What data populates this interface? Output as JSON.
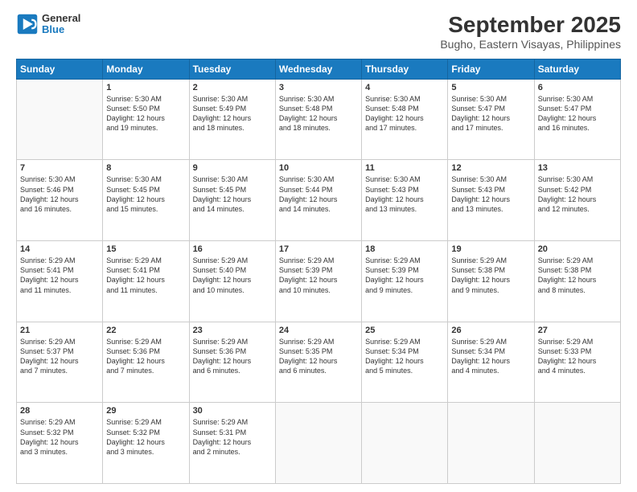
{
  "header": {
    "logo_line1": "General",
    "logo_line2": "Blue",
    "title": "September 2025",
    "subtitle": "Bugho, Eastern Visayas, Philippines"
  },
  "days": [
    "Sunday",
    "Monday",
    "Tuesday",
    "Wednesday",
    "Thursday",
    "Friday",
    "Saturday"
  ],
  "weeks": [
    [
      {
        "day": "",
        "info": ""
      },
      {
        "day": "1",
        "info": "Sunrise: 5:30 AM\nSunset: 5:50 PM\nDaylight: 12 hours\nand 19 minutes."
      },
      {
        "day": "2",
        "info": "Sunrise: 5:30 AM\nSunset: 5:49 PM\nDaylight: 12 hours\nand 18 minutes."
      },
      {
        "day": "3",
        "info": "Sunrise: 5:30 AM\nSunset: 5:48 PM\nDaylight: 12 hours\nand 18 minutes."
      },
      {
        "day": "4",
        "info": "Sunrise: 5:30 AM\nSunset: 5:48 PM\nDaylight: 12 hours\nand 17 minutes."
      },
      {
        "day": "5",
        "info": "Sunrise: 5:30 AM\nSunset: 5:47 PM\nDaylight: 12 hours\nand 17 minutes."
      },
      {
        "day": "6",
        "info": "Sunrise: 5:30 AM\nSunset: 5:47 PM\nDaylight: 12 hours\nand 16 minutes."
      }
    ],
    [
      {
        "day": "7",
        "info": "Sunrise: 5:30 AM\nSunset: 5:46 PM\nDaylight: 12 hours\nand 16 minutes."
      },
      {
        "day": "8",
        "info": "Sunrise: 5:30 AM\nSunset: 5:45 PM\nDaylight: 12 hours\nand 15 minutes."
      },
      {
        "day": "9",
        "info": "Sunrise: 5:30 AM\nSunset: 5:45 PM\nDaylight: 12 hours\nand 14 minutes."
      },
      {
        "day": "10",
        "info": "Sunrise: 5:30 AM\nSunset: 5:44 PM\nDaylight: 12 hours\nand 14 minutes."
      },
      {
        "day": "11",
        "info": "Sunrise: 5:30 AM\nSunset: 5:43 PM\nDaylight: 12 hours\nand 13 minutes."
      },
      {
        "day": "12",
        "info": "Sunrise: 5:30 AM\nSunset: 5:43 PM\nDaylight: 12 hours\nand 13 minutes."
      },
      {
        "day": "13",
        "info": "Sunrise: 5:30 AM\nSunset: 5:42 PM\nDaylight: 12 hours\nand 12 minutes."
      }
    ],
    [
      {
        "day": "14",
        "info": "Sunrise: 5:29 AM\nSunset: 5:41 PM\nDaylight: 12 hours\nand 11 minutes."
      },
      {
        "day": "15",
        "info": "Sunrise: 5:29 AM\nSunset: 5:41 PM\nDaylight: 12 hours\nand 11 minutes."
      },
      {
        "day": "16",
        "info": "Sunrise: 5:29 AM\nSunset: 5:40 PM\nDaylight: 12 hours\nand 10 minutes."
      },
      {
        "day": "17",
        "info": "Sunrise: 5:29 AM\nSunset: 5:39 PM\nDaylight: 12 hours\nand 10 minutes."
      },
      {
        "day": "18",
        "info": "Sunrise: 5:29 AM\nSunset: 5:39 PM\nDaylight: 12 hours\nand 9 minutes."
      },
      {
        "day": "19",
        "info": "Sunrise: 5:29 AM\nSunset: 5:38 PM\nDaylight: 12 hours\nand 9 minutes."
      },
      {
        "day": "20",
        "info": "Sunrise: 5:29 AM\nSunset: 5:38 PM\nDaylight: 12 hours\nand 8 minutes."
      }
    ],
    [
      {
        "day": "21",
        "info": "Sunrise: 5:29 AM\nSunset: 5:37 PM\nDaylight: 12 hours\nand 7 minutes."
      },
      {
        "day": "22",
        "info": "Sunrise: 5:29 AM\nSunset: 5:36 PM\nDaylight: 12 hours\nand 7 minutes."
      },
      {
        "day": "23",
        "info": "Sunrise: 5:29 AM\nSunset: 5:36 PM\nDaylight: 12 hours\nand 6 minutes."
      },
      {
        "day": "24",
        "info": "Sunrise: 5:29 AM\nSunset: 5:35 PM\nDaylight: 12 hours\nand 6 minutes."
      },
      {
        "day": "25",
        "info": "Sunrise: 5:29 AM\nSunset: 5:34 PM\nDaylight: 12 hours\nand 5 minutes."
      },
      {
        "day": "26",
        "info": "Sunrise: 5:29 AM\nSunset: 5:34 PM\nDaylight: 12 hours\nand 4 minutes."
      },
      {
        "day": "27",
        "info": "Sunrise: 5:29 AM\nSunset: 5:33 PM\nDaylight: 12 hours\nand 4 minutes."
      }
    ],
    [
      {
        "day": "28",
        "info": "Sunrise: 5:29 AM\nSunset: 5:32 PM\nDaylight: 12 hours\nand 3 minutes."
      },
      {
        "day": "29",
        "info": "Sunrise: 5:29 AM\nSunset: 5:32 PM\nDaylight: 12 hours\nand 3 minutes."
      },
      {
        "day": "30",
        "info": "Sunrise: 5:29 AM\nSunset: 5:31 PM\nDaylight: 12 hours\nand 2 minutes."
      },
      {
        "day": "",
        "info": ""
      },
      {
        "day": "",
        "info": ""
      },
      {
        "day": "",
        "info": ""
      },
      {
        "day": "",
        "info": ""
      }
    ]
  ]
}
